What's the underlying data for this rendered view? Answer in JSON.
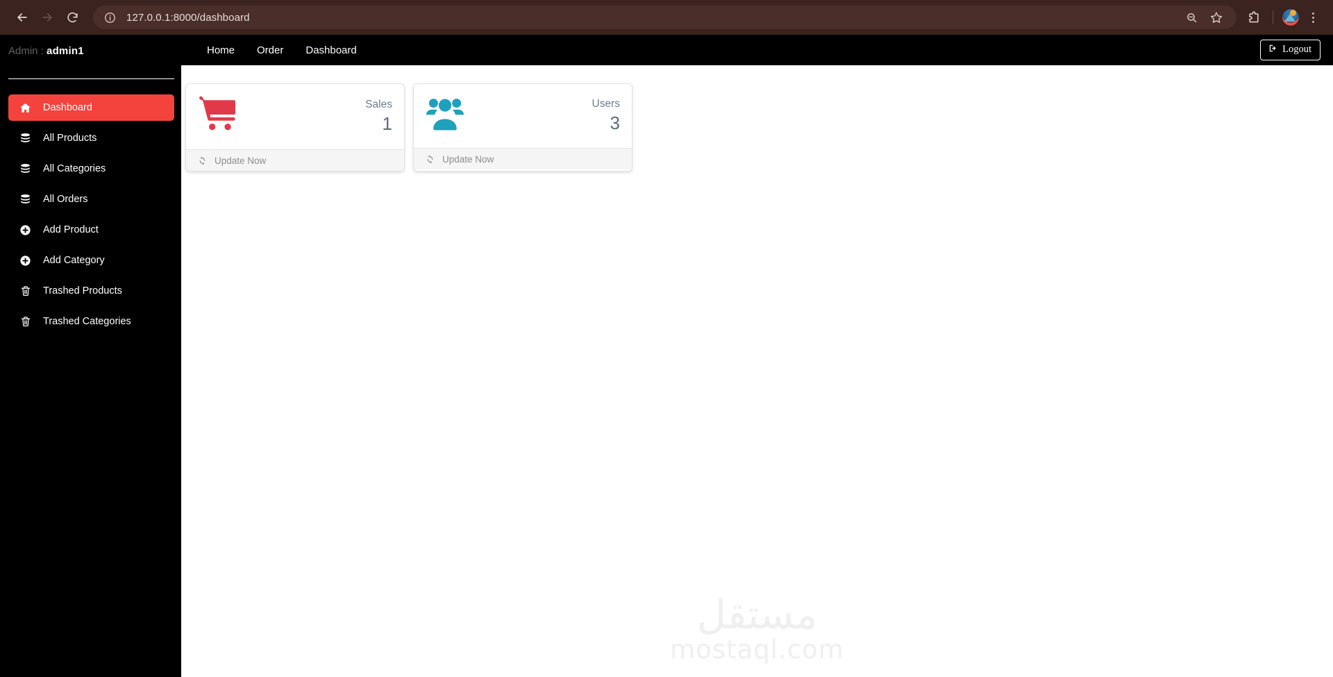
{
  "browser": {
    "back_label": "Back",
    "forward_label": "Forward",
    "reload_label": "Reload",
    "site_info_label": "View site information",
    "url": "127.0.0.1:8000/dashboard",
    "zoom_label": "Zoom",
    "bookmark_label": "Bookmark this tab",
    "extensions_label": "Extensions",
    "profile_label": "Profile",
    "menu_label": "Customize and control Chrome",
    "toolbar_color": "#3b2320",
    "urlbar_color": "#4a2e29"
  },
  "sidebar": {
    "brand_label": "Admin :",
    "brand_user": "admin1",
    "accent_color": "#f4433c",
    "items": [
      {
        "label": "Dashboard",
        "icon": "home-icon",
        "active": true
      },
      {
        "label": "All Products",
        "icon": "database-icon",
        "active": false
      },
      {
        "label": "All Categories",
        "icon": "database-icon",
        "active": false
      },
      {
        "label": "All Orders",
        "icon": "database-icon",
        "active": false
      },
      {
        "label": "Add Product",
        "icon": "plus-circle-icon",
        "active": false
      },
      {
        "label": "Add Category",
        "icon": "plus-circle-icon",
        "active": false
      },
      {
        "label": "Trashed Products",
        "icon": "trash-icon",
        "active": false
      },
      {
        "label": "Trashed Categories",
        "icon": "trash-icon",
        "active": false
      }
    ]
  },
  "topbar": {
    "nav": [
      {
        "label": "Home"
      },
      {
        "label": "Order"
      },
      {
        "label": "Dashboard"
      }
    ],
    "logout_label": "Logout"
  },
  "main": {
    "cards": [
      {
        "label": "Sales",
        "value": "1",
        "footer_label": "Update Now",
        "icon": "shopping-cart-icon",
        "icon_color": "#e03a4a"
      },
      {
        "label": "Users",
        "value": "3",
        "footer_label": "Update Now",
        "icon": "users-icon",
        "icon_color": "#1fa0bd"
      }
    ],
    "watermark_arabic": "مستقل",
    "watermark_latin": "mostaql.com"
  }
}
